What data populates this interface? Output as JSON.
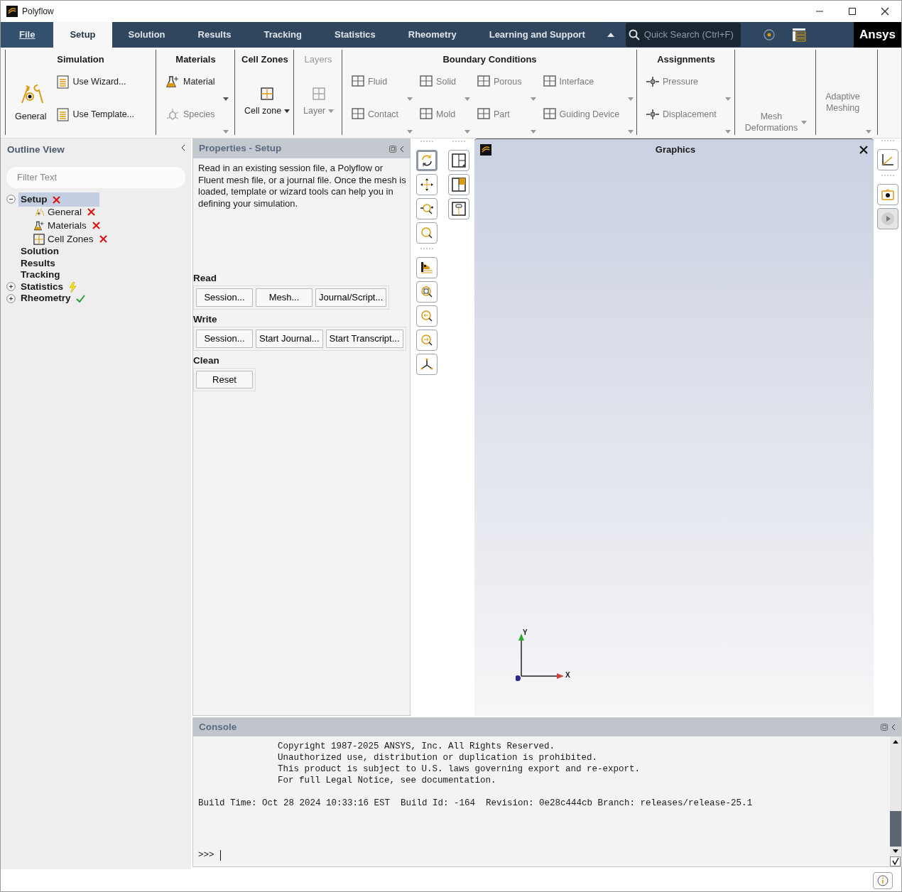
{
  "window": {
    "title": "Polyflow"
  },
  "menu_tabs": [
    {
      "label": "File",
      "selected": false
    },
    {
      "label": "Setup",
      "selected": true
    },
    {
      "label": "Solution",
      "selected": false
    },
    {
      "label": "Results",
      "selected": false
    },
    {
      "label": "Tracking",
      "selected": false
    },
    {
      "label": "Statistics",
      "selected": false
    },
    {
      "label": "Rheometry",
      "selected": false
    },
    {
      "label": "Learning and Support",
      "selected": false
    }
  ],
  "search": {
    "placeholder": "Quick Search (Ctrl+F)"
  },
  "logo": "Ansys",
  "ribbon": [
    {
      "title": "Simulation",
      "items": [
        {
          "label": "General",
          "kind": "general",
          "disabled": false,
          "dropdown": false
        },
        {
          "label": "Use Wizard...",
          "kind": "document",
          "disabled": false,
          "dropdown": false
        },
        {
          "label": "Use Template...",
          "kind": "document",
          "disabled": false,
          "dropdown": false
        }
      ]
    },
    {
      "title": "Materials",
      "items": [
        {
          "label": "Material",
          "kind": "material",
          "disabled": false,
          "dropdown": true
        },
        {
          "label": "Species",
          "kind": "species",
          "disabled": true,
          "dropdown": true
        }
      ]
    },
    {
      "title": "Cell Zones",
      "items": [
        {
          "label": "Cell zone",
          "kind": "cell-zone",
          "disabled": false,
          "dropdown": true
        }
      ]
    },
    {
      "title": "Layers",
      "disabled": true,
      "items": [
        {
          "label": "Layer",
          "kind": "cell-zone",
          "disabled": true,
          "dropdown": true
        }
      ]
    },
    {
      "title": "Boundary Conditions",
      "items": [
        {
          "label": "Fluid",
          "kind": "zone",
          "disabled": true,
          "dropdown": true
        },
        {
          "label": "Solid",
          "kind": "zone",
          "disabled": true,
          "dropdown": true
        },
        {
          "label": "Porous",
          "kind": "zone",
          "disabled": true,
          "dropdown": true
        },
        {
          "label": "Interface",
          "kind": "zone",
          "disabled": true,
          "dropdown": true
        },
        {
          "label": "Contact",
          "kind": "zone",
          "disabled": true,
          "dropdown": true
        },
        {
          "label": "Mold",
          "kind": "zone",
          "disabled": true,
          "dropdown": true
        },
        {
          "label": "Part",
          "kind": "zone",
          "disabled": true,
          "dropdown": true
        },
        {
          "label": "Guiding Device",
          "kind": "zone",
          "disabled": true,
          "dropdown": true
        }
      ]
    },
    {
      "title": "Assignments",
      "items": [
        {
          "label": "Pressure",
          "kind": "point",
          "disabled": true,
          "dropdown": true
        },
        {
          "label": "Displacement",
          "kind": "point",
          "disabled": true,
          "dropdown": true
        }
      ]
    },
    {
      "items": [
        {
          "label": "Mesh Deformations",
          "kind": "text-bottom",
          "disabled": true,
          "dropdown": true
        }
      ]
    },
    {
      "items": [
        {
          "label": "Adaptive Meshing",
          "kind": "text",
          "disabled": true,
          "dropdown": true
        }
      ]
    }
  ],
  "outline": {
    "title": "Outline View",
    "filter_placeholder": "Filter Text",
    "tree": [
      {
        "label": "Setup",
        "expanded": true,
        "selected": true,
        "error": true,
        "warning": false,
        "done": false,
        "children": [
          {
            "label": "General",
            "kind": "general",
            "error": true
          },
          {
            "label": "Materials",
            "kind": "material",
            "error": true
          },
          {
            "label": "Cell Zones",
            "kind": "cell-zone",
            "error": true
          }
        ]
      },
      {
        "label": "Solution",
        "selected": false,
        "error": false,
        "warning": false,
        "done": false
      },
      {
        "label": "Results",
        "selected": false,
        "error": false,
        "warning": false,
        "done": false
      },
      {
        "label": "Tracking",
        "selected": false,
        "error": false,
        "warning": false,
        "done": false
      },
      {
        "label": "Statistics",
        "expanded": false,
        "selected": false,
        "error": false,
        "warning": true,
        "done": false
      },
      {
        "label": "Rheometry",
        "expanded": false,
        "selected": false,
        "error": false,
        "warning": false,
        "done": true
      }
    ]
  },
  "properties": {
    "title": "Properties - Setup",
    "description": "Read in an existing session file, a Polyflow or Fluent mesh file, or a journal file. Once the mesh is loaded, template or wizard tools can help you in defining your simulation.",
    "sections": [
      {
        "title": "Read",
        "buttons": [
          "Session...",
          "Mesh...",
          "Journal/Script..."
        ]
      },
      {
        "title": "Write",
        "buttons": [
          "Session...",
          "Start Journal...",
          "Start Transcript..."
        ]
      },
      {
        "title": "Clean",
        "buttons": [
          "Reset"
        ]
      }
    ]
  },
  "view_tools": [
    {
      "kind": "rotate",
      "selected": true
    },
    {
      "kind": "pan",
      "selected": false
    },
    {
      "kind": "zoom-in-out",
      "selected": false
    },
    {
      "kind": "zoom",
      "selected": false
    },
    {
      "kind": "fit",
      "selected": false
    },
    {
      "kind": "zoom-box",
      "selected": false
    },
    {
      "kind": "zoom-previous",
      "selected": false
    },
    {
      "kind": "zoom-next",
      "selected": false
    },
    {
      "kind": "axes",
      "selected": false
    }
  ],
  "graphics": {
    "title": "Graphics",
    "axis_labels": [
      "Y",
      "X"
    ]
  },
  "console": {
    "title": "Console",
    "lines": [
      {
        "text": "Copyright 1987-2025 ANSYS, Inc. All Rights Reserved.",
        "indented": true
      },
      {
        "text": "Unauthorized use, distribution or duplication is prohibited.",
        "indented": true
      },
      {
        "text": "This product is subject to U.S. laws governing export and re-export.",
        "indented": true
      },
      {
        "text": "For full Legal Notice, see documentation.",
        "indented": true
      },
      {
        "text": "Build Time: Oct 28 2024 10:33:16 EST  Build Id: -164  Revision: 0e28c444cb Branch: releases/release-25.1",
        "indented": false
      }
    ],
    "prompt": ">>>"
  }
}
